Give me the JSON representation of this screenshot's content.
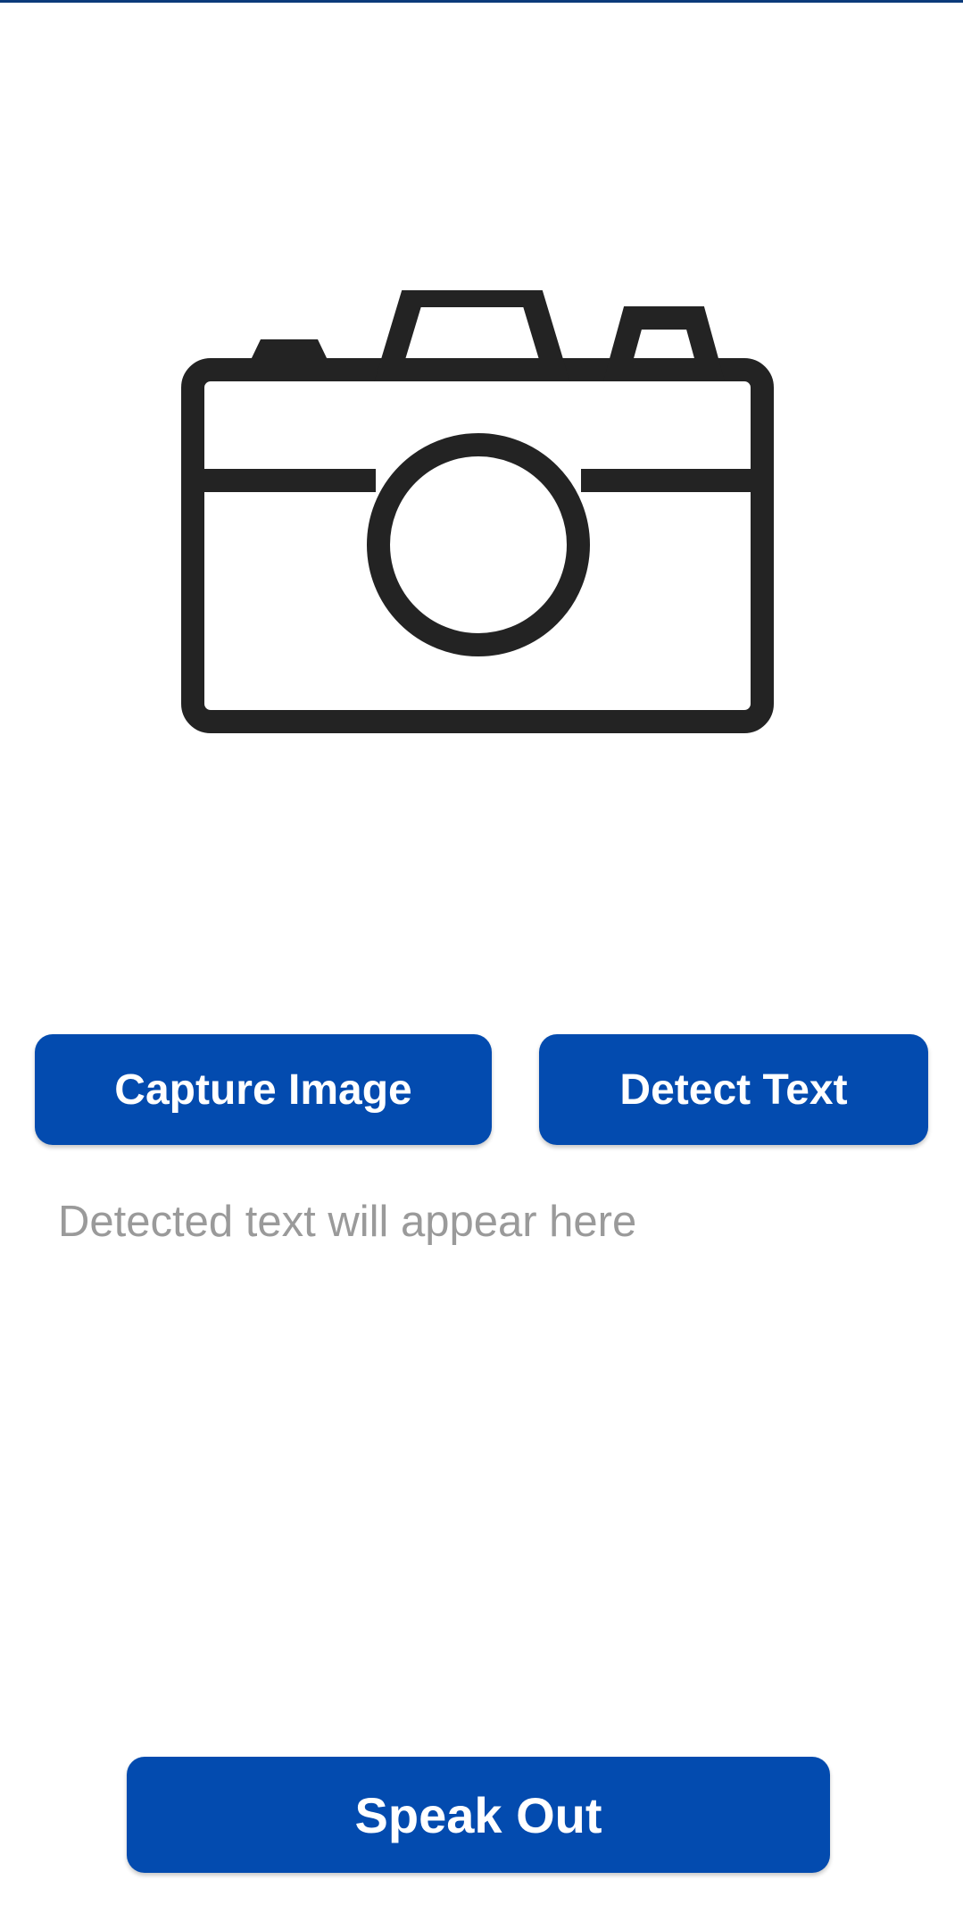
{
  "preview": {
    "icon": "camera-icon"
  },
  "buttons": {
    "capture_label": "Capture Image",
    "detect_label": "Detect Text",
    "speak_label": "Speak Out"
  },
  "result": {
    "placeholder": "Detected text will appear here"
  },
  "colors": {
    "button_bg": "#034baf",
    "button_text": "#ffffff",
    "placeholder_text": "#9a9a9a",
    "icon_stroke": "#232323"
  }
}
